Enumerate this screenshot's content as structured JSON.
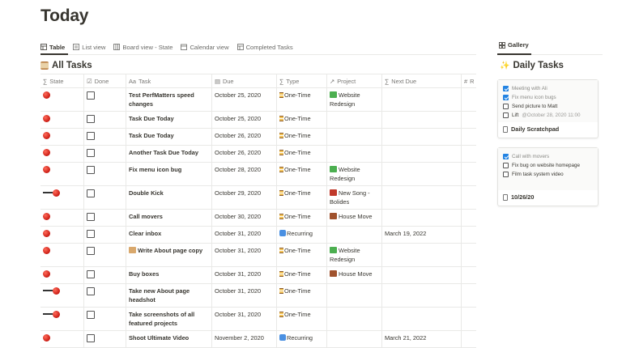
{
  "page": {
    "title": "Today"
  },
  "tabs": [
    {
      "label": "Table",
      "icon": "table-icon",
      "active": true
    },
    {
      "label": "List view",
      "icon": "list-icon",
      "active": false
    },
    {
      "label": "Board view - State",
      "icon": "board-icon",
      "active": false
    },
    {
      "label": "Calendar view",
      "icon": "calendar-icon",
      "active": false
    },
    {
      "label": "Completed Tasks",
      "icon": "table-icon",
      "active": false
    }
  ],
  "section": {
    "title": "All Tasks",
    "icon": "abacus-icon"
  },
  "columns": [
    {
      "label": "State",
      "icon": "sigma-icon"
    },
    {
      "label": "Done",
      "icon": "checkbox-icon"
    },
    {
      "label": "Task",
      "icon": "text-icon"
    },
    {
      "label": "Due",
      "icon": "calendar-icon"
    },
    {
      "label": "Type",
      "icon": "sigma-icon"
    },
    {
      "label": "Project",
      "icon": "relation-arrow-icon"
    },
    {
      "label": "Next Due",
      "icon": "sigma-icon"
    },
    {
      "label": "R",
      "icon": "hash-icon"
    }
  ],
  "rows": [
    {
      "state": "red-dot",
      "task": "Test PerfMatters speed changes",
      "due": "October 25, 2020",
      "type": "One-Time",
      "project": "Website Redesign",
      "project_icon": "money-icon",
      "next_due": ""
    },
    {
      "state": "red-dot",
      "task": "Task Due Today",
      "due": "October 25, 2020",
      "type": "One-Time",
      "project": "",
      "project_icon": "",
      "next_due": ""
    },
    {
      "state": "red-dot",
      "task": "Task Due Today",
      "due": "October 26, 2020",
      "type": "One-Time",
      "project": "",
      "project_icon": "",
      "next_due": ""
    },
    {
      "state": "red-dot",
      "task": "Another Task Due Today",
      "due": "October 26, 2020",
      "type": "One-Time",
      "project": "",
      "project_icon": "",
      "next_due": ""
    },
    {
      "state": "red-dot",
      "task": "Fix menu icon bug",
      "due": "October 28, 2020",
      "type": "One-Time",
      "project": "Website Redesign",
      "project_icon": "money-icon",
      "next_due": ""
    },
    {
      "state": "pin",
      "task": "Double Kick",
      "due": "October 29, 2020",
      "type": "One-Time",
      "project": "New Song - Bolides",
      "project_icon": "guitar-icon",
      "next_due": ""
    },
    {
      "state": "red-dot",
      "task": "Call movers",
      "due": "October 30, 2020",
      "type": "One-Time",
      "project": "House Move",
      "project_icon": "house-icon",
      "next_due": ""
    },
    {
      "state": "red-dot",
      "task": "Clear inbox",
      "due": "October 31, 2020",
      "type": "Recurring",
      "project": "",
      "project_icon": "",
      "next_due": "March 19, 2022"
    },
    {
      "state": "red-dot",
      "task": "Write About page copy",
      "task_icon": "memo-icon",
      "due": "October 31, 2020",
      "type": "One-Time",
      "project": "Website Redesign",
      "project_icon": "money-icon",
      "next_due": ""
    },
    {
      "state": "red-dot",
      "task": "Buy boxes",
      "due": "October 31, 2020",
      "type": "One-Time",
      "project": "House Move",
      "project_icon": "house-icon",
      "next_due": ""
    },
    {
      "state": "pin",
      "task": "Take new About page headshot",
      "due": "October 31, 2020",
      "type": "One-Time",
      "project": "",
      "project_icon": "",
      "next_due": ""
    },
    {
      "state": "pin",
      "task": "Take screenshots of all featured projects",
      "due": "October 31, 2020",
      "type": "One-Time",
      "project": "",
      "project_icon": "",
      "next_due": ""
    },
    {
      "state": "red-dot",
      "task": "Shoot Ultimate Video",
      "due": "November 2, 2020",
      "type": "Recurring",
      "project": "",
      "project_icon": "",
      "next_due": "March 21, 2022"
    }
  ],
  "gallery": {
    "tab_label": "Gallery",
    "title": "Daily Tasks",
    "title_icon": "sparkle-icon",
    "cards": [
      {
        "items": [
          {
            "text": "Meeting with Ali",
            "checked": true,
            "date": ""
          },
          {
            "text": "Fix menu icon bugs",
            "checked": true,
            "date": ""
          },
          {
            "text": "Send picture to Matt",
            "checked": false,
            "date": ""
          },
          {
            "text": "Lift",
            "checked": false,
            "date": "@October 28, 2020 11:00"
          }
        ],
        "footer": "Daily Scratchpad"
      },
      {
        "items": [
          {
            "text": "Call with movers",
            "checked": true,
            "date": ""
          },
          {
            "text": "Fix bug on website homepage",
            "checked": false,
            "date": ""
          },
          {
            "text": "Film task system video",
            "checked": false,
            "date": ""
          }
        ],
        "footer": "10/26/20"
      }
    ]
  },
  "colors": {
    "accent": "#2383e2",
    "state_red": "#d8281c",
    "border": "#e9e9e7",
    "text": "#37352f",
    "muted": "#787774"
  }
}
